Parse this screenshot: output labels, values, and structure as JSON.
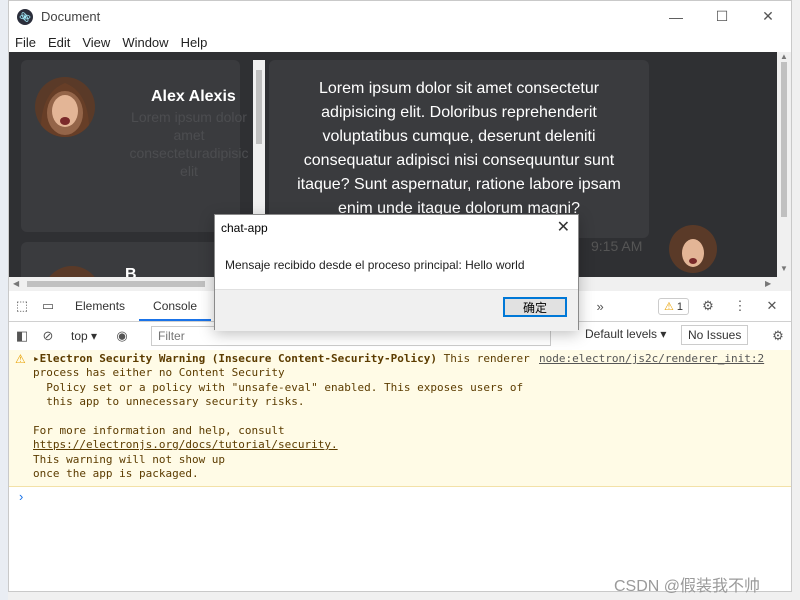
{
  "window": {
    "title": "Document",
    "minimize_icon": "minimize-icon",
    "maximize_icon": "maximize-icon",
    "close_icon": "close-icon"
  },
  "menu": [
    "File",
    "Edit",
    "View",
    "Window",
    "Help"
  ],
  "contacts": [
    {
      "name": "Alex Alexis",
      "preview": "Lorem ipsum dolor amet consecteturadipisic elit"
    },
    {
      "name": "B"
    }
  ],
  "message": {
    "text": "Lorem ipsum dolor sit amet consectetur adipisicing elit. Doloribus reprehenderit voluptatibus cumque, deserunt deleniti consequatur adipisci nisi consequuntur sunt itaque? Sunt aspernatur, ratione labore ipsam enim unde itaque dolorum magni?",
    "time": "9:15 AM"
  },
  "dialog": {
    "title": "chat-app",
    "message": "Mensaje recibido desde el proceso principal: Hello world",
    "ok": "确定"
  },
  "devtools": {
    "tabs": [
      "Elements",
      "Console"
    ],
    "active_tab": "Console",
    "overflow": "»",
    "warning_count": "1",
    "context": "top",
    "filter_placeholder": "Filter",
    "levels": "Default levels",
    "no_issues": "No Issues",
    "warning": {
      "head": "Electron Security Warning (Insecure Content-Security-Policy)",
      "tail": " This renderer",
      "source": "node:electron/js2c/renderer_init:2",
      "lines": [
        "process has either no Content Security",
        "  Policy set or a policy with \"unsafe-eval\" enabled. This exposes users of",
        "  this app to unnecessary security risks.",
        "",
        "For more information and help, consult",
        "https://electronjs.org/docs/tutorial/security.",
        "This warning will not show up",
        "once the app is packaged."
      ]
    }
  },
  "watermark": "CSDN @假装我不帅",
  "colors": {
    "accent": "#1a73e8",
    "warning": "#e8a000",
    "chat_bg": "#2f3033",
    "bubble_bg": "#3a3b3e",
    "warning_bg": "#fffbe6"
  }
}
